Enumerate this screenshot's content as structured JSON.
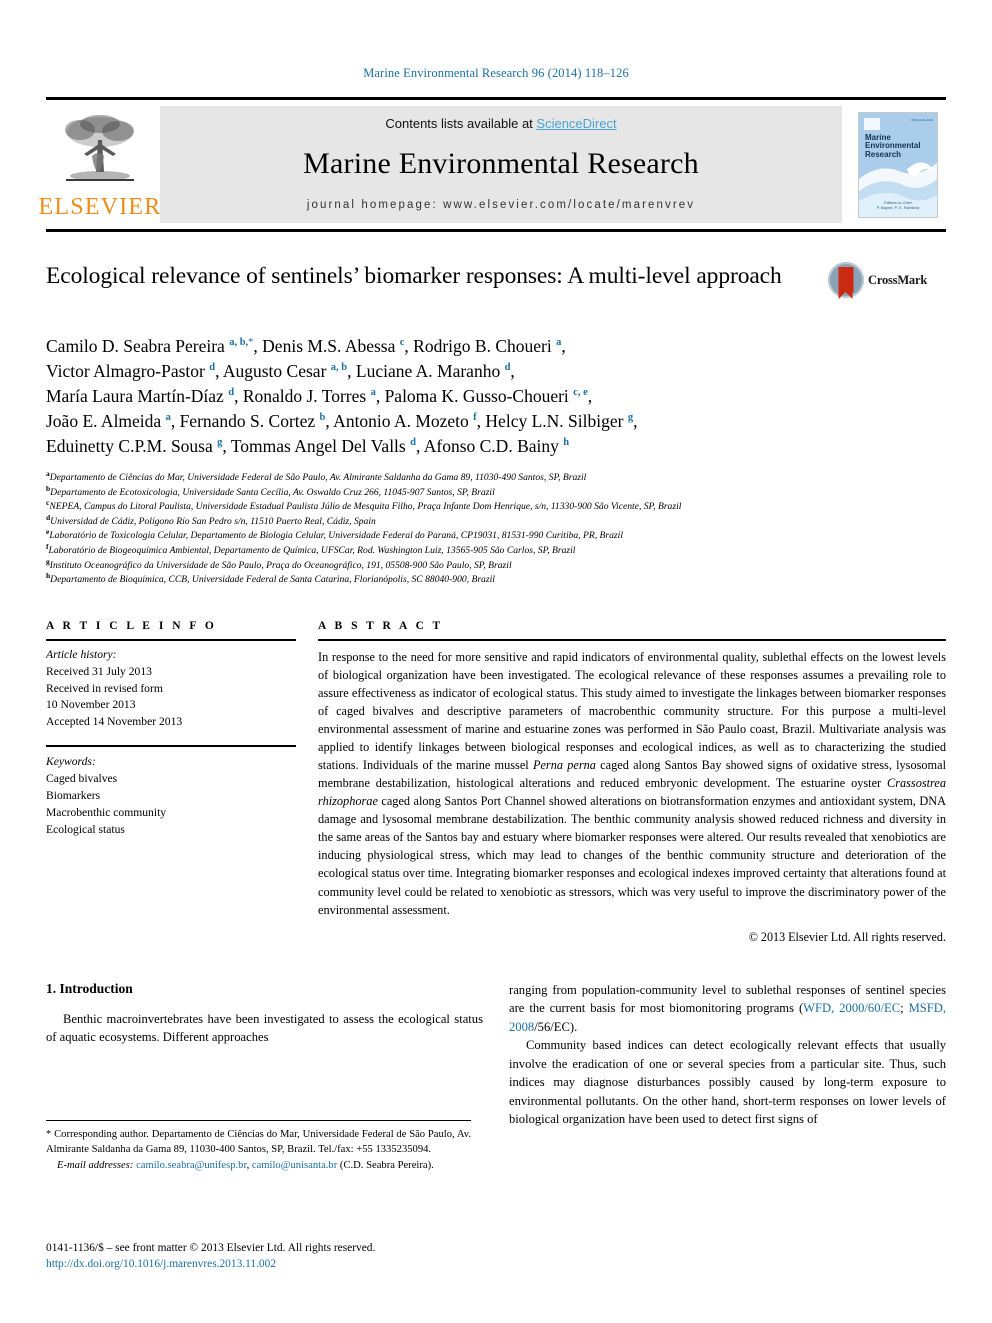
{
  "running_head": "Marine Environmental Research 96 (2014) 118–126",
  "masthead": {
    "publisher_name": "ELSEVIER",
    "contents_prefix": "Contents lists available at ",
    "sciencedirect": "ScienceDirect",
    "journal_title": "Marine Environmental Research",
    "homepage": "journal homepage: www.elsevier.com/locate/marenvrev",
    "cover": {
      "title": "Marine\nEnvironmental\nResearch",
      "issn_code": "ISSN 0141-1136",
      "editors": "Editors-in-Chief\nP. Bayne, P. S. Rainbow"
    }
  },
  "article": {
    "title": "Ecological relevance of sentinels’ biomarker responses: A multi-level approach",
    "crossmark_label": "CrossMark",
    "authors_html": "Camilo D. Seabra Pereira <sup>a, b,</sup><sup class=\"star\">*</sup>, Denis M.S. Abessa <sup>c</sup>, Rodrigo B. Choueri <sup>a</sup>,<br>Victor Almagro-Pastor <sup>d</sup>, Augusto Cesar <sup>a, b</sup>, Luciane A. Maranho <sup>d</sup>,<br>María Laura Martín-Díaz <sup>d</sup>, Ronaldo J. Torres <sup>a</sup>, Paloma K. Gusso-Choueri <sup>c, e</sup>,<br>João E. Almeida <sup>a</sup>, Fernando S. Cortez <sup>b</sup>, Antonio A. Mozeto <sup>f</sup>, Helcy L.N. Silbiger <sup>g</sup>,<br>Eduinetty C.P.M. Sousa <sup>g</sup>, Tommas Angel Del Valls <sup>d</sup>, Afonso C.D. Bainy <sup>h</sup>",
    "affiliations": [
      {
        "mark": "a",
        "text": "Departamento de Ciências do Mar, Universidade Federal de São Paulo, Av. Almirante Saldanha da Gama 89, 11030-490 Santos, SP, Brazil"
      },
      {
        "mark": "b",
        "text": "Departamento de Ecotoxicologia, Universidade Santa Cecília, Av. Oswaldo Cruz 266, 11045-907 Santos, SP, Brazil"
      },
      {
        "mark": "c",
        "text": "NEPEA, Campus do Litoral Paulista, Universidade Estadual Paulista Júlio de Mesquita Filho, Praça Infante Dom Henrique, s/n, 11330-900 São Vicente, SP, Brazil"
      },
      {
        "mark": "d",
        "text": "Universidad de Cádiz, Polígono Río San Pedro s/n, 11510 Puerto Real, Cádiz, Spain"
      },
      {
        "mark": "e",
        "text": "Laboratório de Toxicologia Celular, Departamento de Biologia Celular, Universidade Federal do Paraná, CP19031, 81531-990 Curitiba, PR, Brazil"
      },
      {
        "mark": "f",
        "text": "Laboratório de Biogeoquímica Ambiental, Departamento de Química, UFSCar, Rod. Washington Luiz, 13565-905 São Carlos, SP, Brazil"
      },
      {
        "mark": "g",
        "text": "Instituto Oceanográfico da Universidade de São Paulo, Praça do Oceanográfico, 191, 05508-900 São Paulo, SP, Brazil"
      },
      {
        "mark": "h",
        "text": "Departamento de Bioquímica, CCB, Universidade Federal de Santa Catarina, Florianópolis, SC 88040-900, Brazil"
      }
    ]
  },
  "article_info": {
    "heading": "A R T I C L E   I N F O",
    "history_label": "Article history:",
    "history": [
      "Received 31 July 2013",
      "Received in revised form",
      "10 November 2013",
      "Accepted 14 November 2013"
    ],
    "keywords_label": "Keywords:",
    "keywords": [
      "Caged bivalves",
      "Biomarkers",
      "Macrobenthic community",
      "Ecological status"
    ]
  },
  "abstract": {
    "heading": "A B S T R A C T",
    "html": "In response to the need for more sensitive and rapid indicators of environmental quality, sublethal effects on the lowest levels of biological organization have been investigated. The ecological relevance of these responses assumes a prevailing role to assure effectiveness as indicator of ecological status. This study aimed to investigate the linkages between biomarker responses of caged bivalves and descriptive parameters of macrobenthic community structure. For this purpose a multi-level environmental assessment of marine and estuarine zones was performed in São Paulo coast, Brazil. Multivariate analysis was applied to identify linkages between biological responses and ecological indices, as well as to characterizing the studied stations. Individuals of the marine mussel <i>Perna perna</i> caged along Santos Bay showed signs of oxidative stress, lysosomal membrane destabilization, histological alterations and reduced embryonic development. The estuarine oyster <i>Crassostrea rhizophorae</i> caged along Santos Port Channel showed alterations on biotransformation enzymes and antioxidant system, DNA damage and lysosomal membrane destabilization. The benthic community analysis showed reduced richness and diversity in the same areas of the Santos bay and estuary where biomarker responses were altered. Our results revealed that xenobiotics are inducing physiological stress, which may lead to changes of the benthic community structure and deterioration of the ecological status over time. Integrating biomarker responses and ecological indexes improved certainty that alterations found at community level could be related to xenobiotic as stressors, which was very useful to improve the discriminatory power of the environmental assessment.",
    "copyright": "© 2013 Elsevier Ltd. All rights reserved."
  },
  "introduction": {
    "heading": "1.  Introduction",
    "left_para_html": "Benthic macroinvertebrates have been investigated to assess the ecological status of aquatic ecosystems. Different approaches",
    "right_para1_html": "ranging from population-community level to sublethal responses of sentinel species are the current basis for most biomonitoring programs (<a class=\"ref\" href=\"#\">WFD, 2000/60/EC</a>; <a class=\"ref\" href=\"#\">MSFD, 2008</a>/56/EC).",
    "right_para2_html": "Community based indices can detect ecologically relevant effects that usually involve the eradication of one or several species from a particular site. Thus, such indices may diagnose disturbances possibly caused by long-term exposure to environmental pollutants. On the other hand, short-term responses on lower levels of biological organization have been used to detect first signs of"
  },
  "footnote": {
    "corresponding_html": "* Corresponding author. Departamento de Ciências do Mar, Universidade Federal de São Paulo, Av. Almirante Saldanha da Gama 89, 11030-400 Santos, SP, Brazil. Tel./fax: +55 1335235094.",
    "email_html": "<em>E-mail addresses:</em> <a class=\"lnk\" href=\"#\">camilo.seabra@unifesp.br</a>, <a class=\"lnk\" href=\"#\">camilo@unisanta.br</a> (C.D. Seabra Pereira)."
  },
  "page_footer": {
    "front_matter": "0141-1136/$ – see front matter © 2013 Elsevier Ltd. All rights reserved.",
    "doi": "http://dx.doi.org/10.1016/j.marenvres.2013.11.002"
  },
  "colors": {
    "link": "#1a6fa3",
    "sciencedirect": "#4ba3d3",
    "elsevier_orange": "#f08c1b",
    "crossmark_red": "#cc2a10"
  }
}
